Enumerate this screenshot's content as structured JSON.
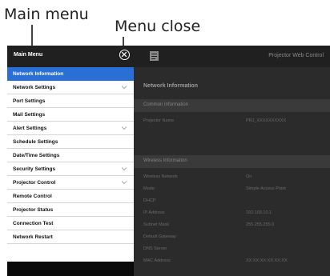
{
  "callouts": {
    "main_menu": "Main menu",
    "menu_close": "Menu close"
  },
  "topbar": {
    "menu_title": "Main Menu",
    "close_icon": "close-circle-icon",
    "app_title": "Projector Web Control"
  },
  "sidebar": {
    "items": [
      {
        "label": "Network Information",
        "active": true,
        "has_children": false
      },
      {
        "label": "Network Settings",
        "active": false,
        "has_children": true
      },
      {
        "label": "Port Settings",
        "active": false,
        "has_children": false
      },
      {
        "label": "Mail Settings",
        "active": false,
        "has_children": false
      },
      {
        "label": "Alert Settings",
        "active": false,
        "has_children": true
      },
      {
        "label": "Schedule Settings",
        "active": false,
        "has_children": false
      },
      {
        "label": "Date/Time Settings",
        "active": false,
        "has_children": false
      },
      {
        "label": "Security Settings",
        "active": false,
        "has_children": true
      },
      {
        "label": "Projector Control",
        "active": false,
        "has_children": true
      },
      {
        "label": "Remote Control",
        "active": false,
        "has_children": false
      },
      {
        "label": "Projector Status",
        "active": false,
        "has_children": false
      },
      {
        "label": "Connection Test",
        "active": false,
        "has_children": false
      },
      {
        "label": "Network Restart",
        "active": false,
        "has_children": false
      }
    ]
  },
  "content": {
    "page_title": "Network Information",
    "common": {
      "header": "Common Information",
      "rows": [
        {
          "key": "Projector Name",
          "value": "PRJ_XXXXXXXXXX"
        }
      ]
    },
    "wireless": {
      "header": "Wireless Information",
      "rows": [
        {
          "key": "Wireless Network",
          "value": "On"
        },
        {
          "key": "Mode",
          "value": "Simple Access Point"
        },
        {
          "key": "DHCP",
          "value": ""
        },
        {
          "key": "IP Address",
          "value": "192.168.10.1"
        },
        {
          "key": "Subnet Mask",
          "value": "255.255.255.0"
        },
        {
          "key": "Default Gateway",
          "value": ""
        },
        {
          "key": "DNS Server",
          "value": ""
        },
        {
          "key": "MAC Address",
          "value": "XX:XX:XX:XX:XX:XX"
        }
      ]
    }
  }
}
